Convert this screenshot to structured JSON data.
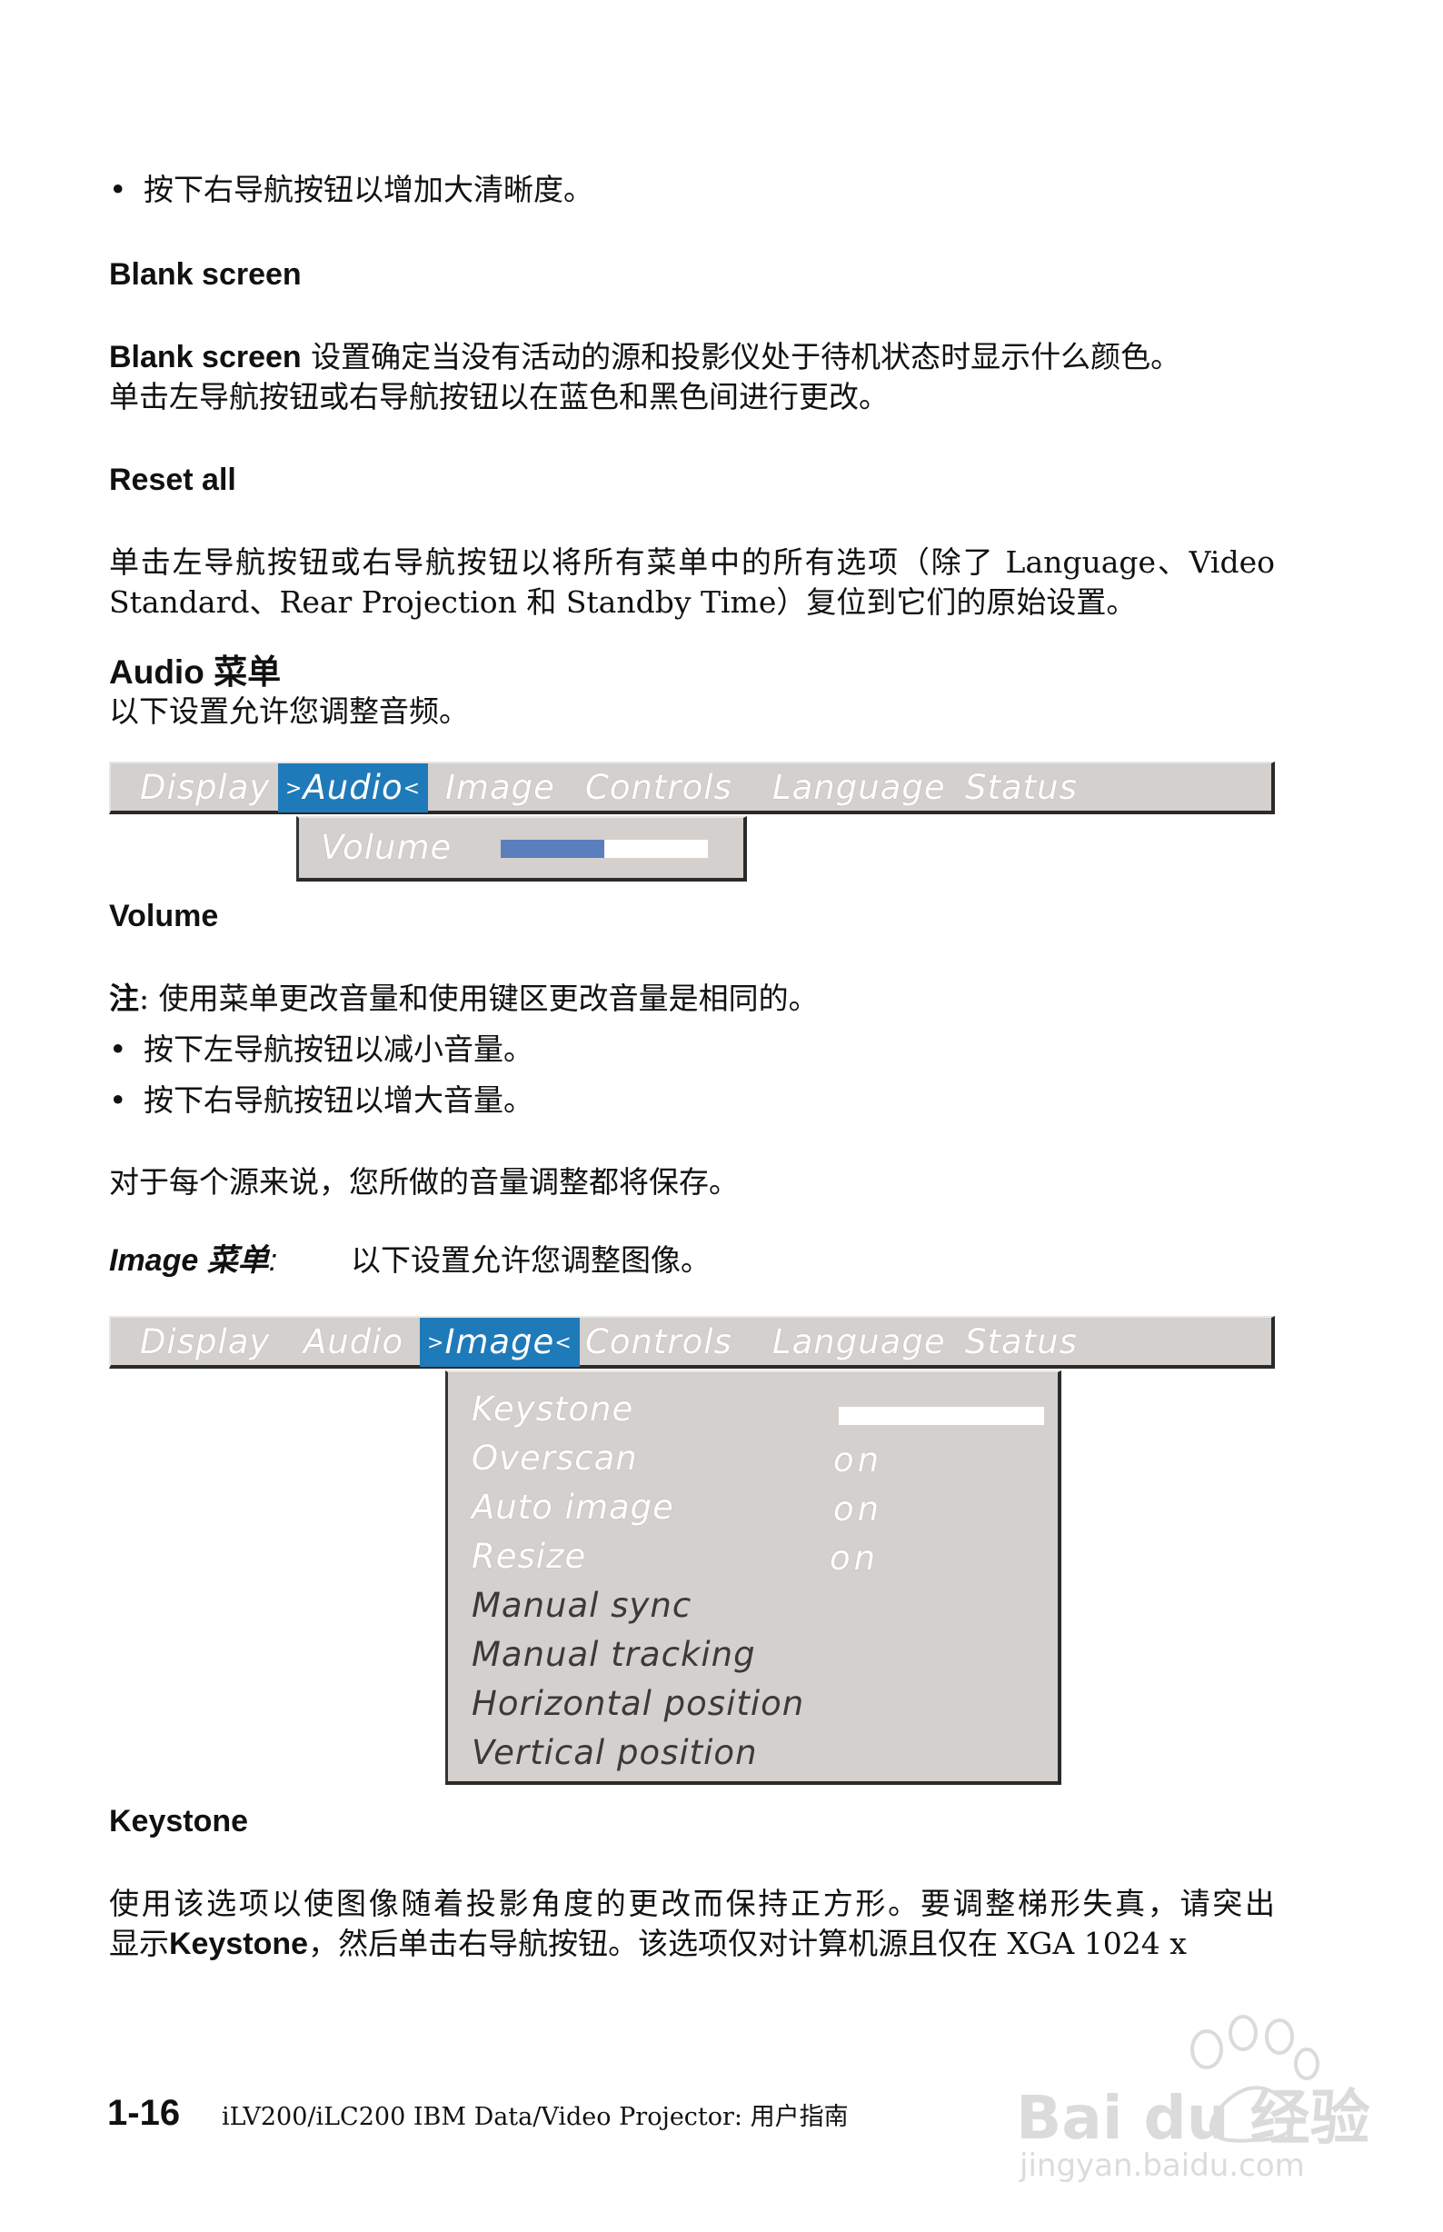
{
  "bullet_sharpness": "按下右导航按钮以增加大清晰度。",
  "blank_screen": {
    "heading": "Blank screen",
    "term": "Blank screen",
    "line1": " 设置确定当没有活动的源和投影仪处于待机状态时显示什么颜色。",
    "line2": "单击左导航按钮或右导航按钮以在蓝色和黑色间进行更改。"
  },
  "reset_all": {
    "heading": "Reset all",
    "line1": "单击左导航按钮或右导航按钮以将所有菜单中的所有选项（除了 Language、Video",
    "line2": "Standard、Rear Projection 和 Standby Time）复位到它们的原始设置。"
  },
  "audio_menu": {
    "heading": "Audio 菜单",
    "intro": "以下设置允许您调整音频。",
    "tabs": [
      {
        "label": "Display"
      },
      {
        "label": "Audio",
        "active": true
      },
      {
        "label": "Image"
      },
      {
        "label": "Controls"
      },
      {
        "label": "Language"
      },
      {
        "label": "Status"
      }
    ],
    "arrow_left": ">",
    "arrow_right": "<",
    "volume_label": "Volume",
    "volume_level": 0.5
  },
  "volume": {
    "heading": "Volume",
    "note_label": "注",
    "note_text": ":  使用菜单更改音量和使用键区更改音量是相同的。",
    "bullet1": "按下左导航按钮以减小音量。",
    "bullet2": "按下右导航按钮以增大音量。",
    "saved": "对于每个源来说，您所做的音量调整都将保存。"
  },
  "image_menu": {
    "heading": "Image 菜单",
    "colon": ":",
    "intro": "以下设置允许您调整图像。",
    "tabs": [
      {
        "label": "Display"
      },
      {
        "label": "Audio"
      },
      {
        "label": "Image",
        "active": true
      },
      {
        "label": "Controls"
      },
      {
        "label": "Language"
      },
      {
        "label": "Status"
      }
    ],
    "items": [
      {
        "label": "Keystone",
        "value": ""
      },
      {
        "label": "Overscan",
        "value": "on"
      },
      {
        "label": "Auto image",
        "value": "on"
      },
      {
        "label": "Resize",
        "value": "on"
      },
      {
        "label": "Manual sync",
        "value": ""
      },
      {
        "label": "Manual tracking",
        "value": ""
      },
      {
        "label": "Horizontal position",
        "value": ""
      },
      {
        "label": "Vertical position",
        "value": ""
      }
    ],
    "keystone_level": 0
  },
  "keystone": {
    "heading": "Keystone",
    "line1": "使用该选项以使图像随着投影角度的更改而保持正方形。要调整梯形失真，请突出",
    "line2_pre": "显示 ",
    "line2_term": "Keystone",
    "line2_post": "，然后单击右导航按钮。该选项仅对计算机源且仅在 XGA 1024 x"
  },
  "footer": {
    "page_number": "1-16",
    "title": "iLV200/iLC200 IBM Data/Video Projector: 用户指南"
  },
  "watermark": {
    "brand": "Bai du 经验",
    "url": "jingyan.baidu.com"
  },
  "colors": {
    "menu_bg": "#d4d0cd",
    "menu_active": "#1f7ab9",
    "volume_fill": "#5b7fbd"
  }
}
